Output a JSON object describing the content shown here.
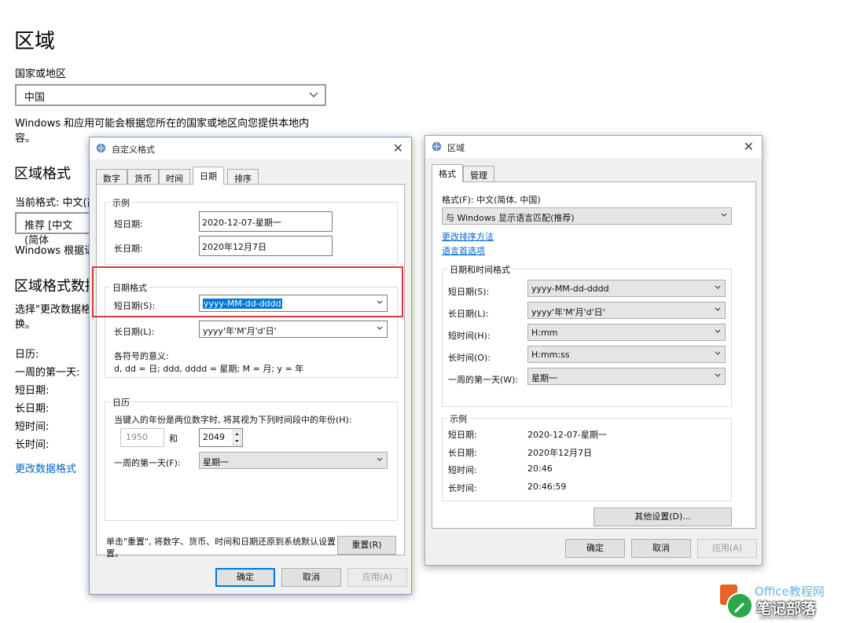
{
  "settings": {
    "title": "区域",
    "country_label": "国家或地区",
    "country_value": "中国",
    "country_note_line1": "Windows 和应用可能会根据您所在的国家或地区向您提供本地内",
    "country_note_line2": "容。",
    "format_heading": "区域格式",
    "current_format": "当前格式: 中文(简",
    "recommended_value": "推荐 [中文(简体",
    "format_note": "Windows 根据语",
    "data_heading": "区域格式数据",
    "data_note_line1": "选择\"更改数据格",
    "data_note_line2": "换。",
    "rows": [
      "日历:",
      "一周的第一天:",
      "短日期:",
      "长日期:",
      "短时间:",
      "长时间:"
    ],
    "change_link": "更改数据格式"
  },
  "custom_dialog": {
    "title": "自定义格式",
    "close": "✕",
    "tabs": [
      "数字",
      "货币",
      "时间",
      "日期",
      "排序"
    ],
    "active_tab": 3,
    "sample": {
      "title": "示例",
      "short_label": "短日期:",
      "short_value": "2020-12-07-星期一",
      "long_label": "长日期:",
      "long_value": "2020年12月7日"
    },
    "date_formats": {
      "title": "日期格式",
      "short_label": "短日期(S):",
      "short_value": "yyyy-MM-dd-dddd",
      "long_label": "长日期(L):",
      "long_value": "yyyy'年'M'月'd'日'",
      "meaning_title": "各符号的意义:",
      "meaning_text": "d, dd = 日;  ddd, dddd = 星期;  M = 月;  y = 年"
    },
    "calendar": {
      "title": "日历",
      "desc": "当键入的年份是两位数字时, 将其视为下列时间段中的年份(H):",
      "from_year": "1950",
      "and": "和",
      "to_year": "2049",
      "first_day_label": "一周的第一天(F):",
      "first_day_value": "星期一"
    },
    "reset_note_line1": "单击\"重置\", 将数字、货币、时间和日期还原到系统默认设置",
    "reset_note_line2": "置。",
    "reset_button": "重置(R)",
    "ok": "确定",
    "cancel": "取消",
    "apply": "应用(A)"
  },
  "region_dialog": {
    "title": "区域",
    "close": "✕",
    "tabs": [
      "格式",
      "管理"
    ],
    "active_tab": 0,
    "format_label": "格式(F): 中文(简体, 中国)",
    "format_value": "与 Windows 显示语言匹配(推荐)",
    "link_sort": "更改排序方法",
    "link_lang": "语言首选项",
    "datetime_group": "日期和时间格式",
    "fields": [
      {
        "label": "短日期(S):",
        "value": "yyyy-MM-dd-dddd"
      },
      {
        "label": "长日期(L):",
        "value": "yyyy'年'M'月'd'日'"
      },
      {
        "label": "短时间(H):",
        "value": "H:mm"
      },
      {
        "label": "长时间(O):",
        "value": "H:mm:ss"
      },
      {
        "label": "一周的第一天(W):",
        "value": "星期一"
      }
    ],
    "example_group": "示例",
    "examples": [
      {
        "label": "短日期:",
        "value": "2020-12-07-星期一"
      },
      {
        "label": "长日期:",
        "value": "2020年12月7日"
      },
      {
        "label": "短时间:",
        "value": "20:46"
      },
      {
        "label": "长时间:",
        "value": "20:46:59"
      }
    ],
    "other_settings": "其他设置(D)...",
    "ok": "确定",
    "cancel": "取消",
    "apply": "应用(A)"
  },
  "watermark": {
    "brand": "Office教程网",
    "name": "笔记部落",
    "url": "www.notetribe.com"
  },
  "colors": {
    "highlight_box": "#d9383a",
    "selection": "#0078d7",
    "link": "#0066cc"
  }
}
